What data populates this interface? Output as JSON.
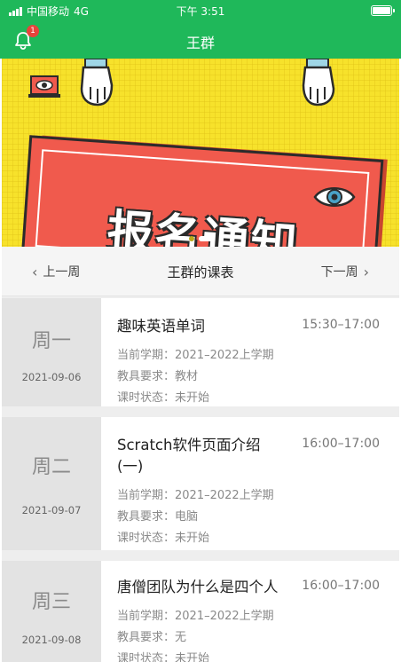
{
  "status_bar": {
    "carrier": "中国移动",
    "network": "4G",
    "time": "下午 3:51"
  },
  "nav": {
    "title": "王群",
    "notification_count": "1"
  },
  "banner": {
    "text": "报名通知"
  },
  "week_nav": {
    "prev_label": "上一周",
    "title": "王群的课表",
    "next_label": "下一周"
  },
  "courses": [
    {
      "day": "周一",
      "date": "2021-09-06",
      "title": "趣味英语单词",
      "time": "15:30–17:00",
      "term": "当前学期：2021–2022上学期",
      "equipment": "教具要求：教材",
      "status": "课时状态：未开始"
    },
    {
      "day": "周二",
      "date": "2021-09-07",
      "title_line1": "Scratch软件页面介绍",
      "title_line2": "(一)",
      "time": "16:00–17:00",
      "term": "当前学期：2021–2022上学期",
      "equipment": "教具要求：电脑",
      "status": "课时状态：未开始"
    },
    {
      "day": "周三",
      "date": "2021-09-08",
      "title": "唐僧团队为什么是四个人",
      "time": "16:00–17:00",
      "term": "当前学期：2021–2022上学期",
      "equipment": "教具要求：无",
      "status": "课时状态：未开始"
    }
  ],
  "colors": {
    "primary": "#1fb85a",
    "badge": "#e8433b",
    "banner_bg": "#f7e22b",
    "banner_card": "#f05a4d"
  }
}
